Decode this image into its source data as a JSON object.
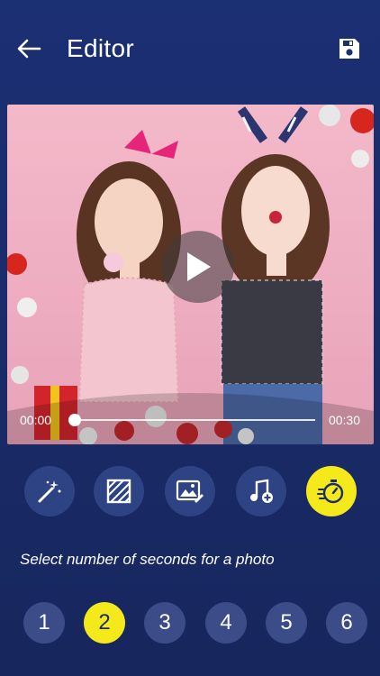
{
  "header": {
    "title": "Editor",
    "back_icon": "arrow-left-icon",
    "save_icon": "floppy-disk-icon"
  },
  "player": {
    "current_time": "00:00",
    "duration": "00:30",
    "progress": 0.0,
    "play_icon": "play-icon"
  },
  "tools": [
    {
      "name": "magic-wand-icon",
      "active": false
    },
    {
      "name": "pattern-frame-icon",
      "active": false
    },
    {
      "name": "image-edit-icon",
      "active": false
    },
    {
      "name": "add-music-icon",
      "active": false
    },
    {
      "name": "timer-icon",
      "active": true
    }
  ],
  "hint": "Select number of seconds for a photo",
  "seconds": {
    "options": [
      "1",
      "2",
      "3",
      "4",
      "5",
      "6"
    ],
    "selected": "2"
  },
  "colors": {
    "accent": "#f4e91a",
    "background": "#1a2c6c",
    "tool_bg": "#2e4383"
  }
}
